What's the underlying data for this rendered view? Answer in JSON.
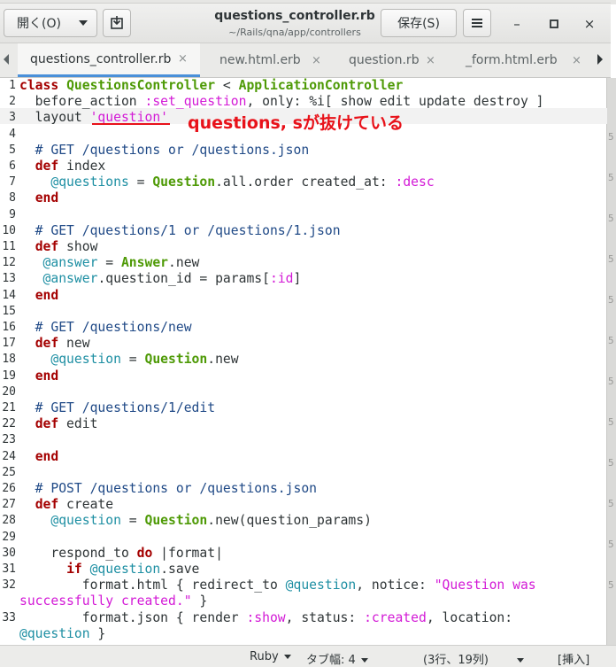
{
  "window": {
    "title": "questions_controller.rb",
    "subtitle": "~/Rails/qna/app/controllers",
    "open_button": "開く(O)",
    "save_button": "保存(S)",
    "minimize": "–",
    "maximize": "□",
    "close": "×"
  },
  "tabs": [
    {
      "label": "questions_controller.rb",
      "active": true
    },
    {
      "label": "new.html.erb"
    },
    {
      "label": "question.rb"
    },
    {
      "label": "_form.html.erb"
    }
  ],
  "annotation": "questions, sが抜けている",
  "right_gutter_numbers": [
    "5",
    "5",
    "5",
    "5",
    "5",
    "5",
    "5",
    "5",
    "5",
    "5",
    "5",
    "5"
  ],
  "code_lines": [
    {
      "n": "1",
      "tokens": [
        [
          "kw",
          "class"
        ],
        [
          "t",
          " "
        ],
        [
          "cls",
          "QuestionsController"
        ],
        [
          "t",
          " < "
        ],
        [
          "cls",
          "ApplicationController"
        ]
      ]
    },
    {
      "n": "2",
      "tokens": [
        [
          "t",
          "  before_action "
        ],
        [
          "sym",
          ":set_question"
        ],
        [
          "t",
          ", only: %i[ show edit update destroy ]"
        ]
      ]
    },
    {
      "n": "3",
      "tokens": [
        [
          "t",
          "  layout "
        ],
        [
          "str",
          "'question'"
        ]
      ]
    },
    {
      "n": "4",
      "tokens": []
    },
    {
      "n": "5",
      "tokens": [
        [
          "cmt",
          "  # GET /questions or /questions.json"
        ]
      ]
    },
    {
      "n": "6",
      "tokens": [
        [
          "t",
          "  "
        ],
        [
          "kw",
          "def"
        ],
        [
          "t",
          " index"
        ]
      ]
    },
    {
      "n": "7",
      "tokens": [
        [
          "t",
          "    "
        ],
        [
          "ivar",
          "@questions"
        ],
        [
          "t",
          " = "
        ],
        [
          "cls",
          "Question"
        ],
        [
          "t",
          ".all.order created_at: "
        ],
        [
          "sym",
          ":desc"
        ]
      ]
    },
    {
      "n": "8",
      "tokens": [
        [
          "t",
          "  "
        ],
        [
          "kw",
          "end"
        ]
      ]
    },
    {
      "n": "9",
      "tokens": []
    },
    {
      "n": "10",
      "tokens": [
        [
          "cmt",
          "  # GET /questions/1 or /questions/1.json"
        ]
      ]
    },
    {
      "n": "11",
      "tokens": [
        [
          "t",
          "  "
        ],
        [
          "kw",
          "def"
        ],
        [
          "t",
          " show"
        ]
      ]
    },
    {
      "n": "12",
      "tokens": [
        [
          "t",
          "   "
        ],
        [
          "ivar",
          "@answer"
        ],
        [
          "t",
          " = "
        ],
        [
          "cls",
          "Answer"
        ],
        [
          "t",
          ".new"
        ]
      ]
    },
    {
      "n": "13",
      "tokens": [
        [
          "t",
          "   "
        ],
        [
          "ivar",
          "@answer"
        ],
        [
          "t",
          ".question_id = params["
        ],
        [
          "sym",
          ":id"
        ],
        [
          "t",
          "]"
        ]
      ]
    },
    {
      "n": "14",
      "tokens": [
        [
          "t",
          "  "
        ],
        [
          "kw",
          "end"
        ]
      ]
    },
    {
      "n": "15",
      "tokens": []
    },
    {
      "n": "16",
      "tokens": [
        [
          "cmt",
          "  # GET /questions/new"
        ]
      ]
    },
    {
      "n": "17",
      "tokens": [
        [
          "t",
          "  "
        ],
        [
          "kw",
          "def"
        ],
        [
          "t",
          " new"
        ]
      ]
    },
    {
      "n": "18",
      "tokens": [
        [
          "t",
          "    "
        ],
        [
          "ivar",
          "@question"
        ],
        [
          "t",
          " = "
        ],
        [
          "cls",
          "Question"
        ],
        [
          "t",
          ".new"
        ]
      ]
    },
    {
      "n": "19",
      "tokens": [
        [
          "t",
          "  "
        ],
        [
          "kw",
          "end"
        ]
      ]
    },
    {
      "n": "20",
      "tokens": []
    },
    {
      "n": "21",
      "tokens": [
        [
          "cmt",
          "  # GET /questions/1/edit"
        ]
      ]
    },
    {
      "n": "22",
      "tokens": [
        [
          "t",
          "  "
        ],
        [
          "kw",
          "def"
        ],
        [
          "t",
          " edit"
        ]
      ]
    },
    {
      "n": "23",
      "tokens": []
    },
    {
      "n": "24",
      "tokens": [
        [
          "t",
          "  "
        ],
        [
          "kw",
          "end"
        ]
      ]
    },
    {
      "n": "25",
      "tokens": []
    },
    {
      "n": "26",
      "tokens": [
        [
          "cmt",
          "  # POST /questions or /questions.json"
        ]
      ]
    },
    {
      "n": "27",
      "tokens": [
        [
          "t",
          "  "
        ],
        [
          "kw",
          "def"
        ],
        [
          "t",
          " create"
        ]
      ]
    },
    {
      "n": "28",
      "tokens": [
        [
          "t",
          "    "
        ],
        [
          "ivar",
          "@question"
        ],
        [
          "t",
          " = "
        ],
        [
          "cls",
          "Question"
        ],
        [
          "t",
          ".new(question_params)"
        ]
      ]
    },
    {
      "n": "29",
      "tokens": []
    },
    {
      "n": "30",
      "tokens": [
        [
          "t",
          "    respond_to "
        ],
        [
          "kw",
          "do"
        ],
        [
          "t",
          " |format|"
        ]
      ]
    },
    {
      "n": "31",
      "tokens": [
        [
          "t",
          "      "
        ],
        [
          "kw",
          "if"
        ],
        [
          "t",
          " "
        ],
        [
          "ivar",
          "@question"
        ],
        [
          "t",
          ".save"
        ]
      ]
    },
    {
      "n": "32",
      "tokens": [
        [
          "t",
          "        format.html { redirect_to "
        ],
        [
          "ivar",
          "@question"
        ],
        [
          "t",
          ", notice: "
        ],
        [
          "str",
          "\"Question was"
        ]
      ]
    },
    {
      "n": "",
      "tokens": [
        [
          "str",
          "successfully created.\""
        ],
        [
          "t",
          " }"
        ]
      ]
    },
    {
      "n": "33",
      "tokens": [
        [
          "t",
          "        format.json { render "
        ],
        [
          "sym",
          ":show"
        ],
        [
          "t",
          ", status: "
        ],
        [
          "sym",
          ":created"
        ],
        [
          "t",
          ", location:"
        ]
      ]
    },
    {
      "n": "",
      "tokens": [
        [
          "ivar",
          "@question"
        ],
        [
          "t",
          " }"
        ]
      ]
    }
  ],
  "status": {
    "language": "Ruby",
    "tab_width": "タブ幅: 4",
    "position": "(3行、19列)",
    "mode": "[挿入]"
  }
}
